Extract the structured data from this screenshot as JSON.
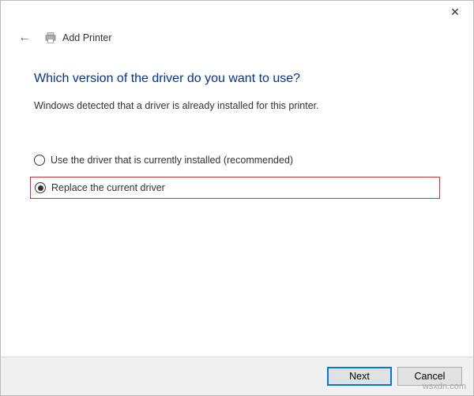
{
  "window": {
    "close_glyph": "✕"
  },
  "header": {
    "back_glyph": "←",
    "title": "Add Printer"
  },
  "content": {
    "heading": "Which version of the driver do you want to use?",
    "subtext": "Windows detected that a driver is already installed for this printer.",
    "option_use_current": "Use the driver that is currently installed (recommended)",
    "option_replace": "Replace the current driver",
    "selected": "replace"
  },
  "footer": {
    "next_label": "Next",
    "cancel_label": "Cancel"
  },
  "watermark": "wsxdn.com"
}
